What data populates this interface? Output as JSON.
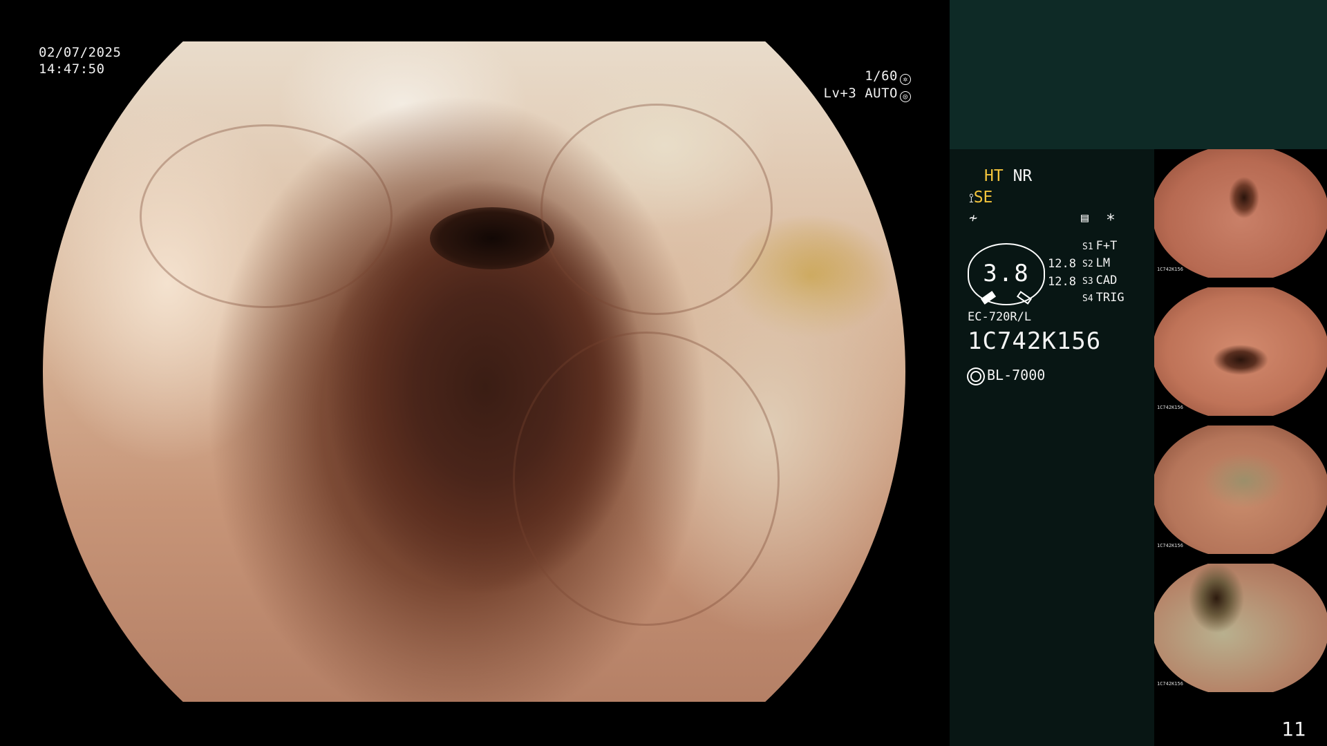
{
  "overlay": {
    "date": "02/07/2025",
    "time": "14:47:50",
    "shutter": "1/60",
    "level": "Lv+3 AUTO"
  },
  "panel": {
    "ht_label": "HT",
    "nr_label": "NR",
    "se_label": "SE",
    "star": "*",
    "dial_value": "3.8",
    "readout_1": "12.8",
    "readout_2": "12.8",
    "modes": [
      {
        "slot": "S1",
        "value": "F+T"
      },
      {
        "slot": "S2",
        "value": "LM"
      },
      {
        "slot": "S3",
        "value": "CAD"
      },
      {
        "slot": "S4",
        "value": "TRIG"
      }
    ],
    "scope_model": "EC-720R/L",
    "serial": "1C742K156",
    "light_source": "BL-7000"
  },
  "thumbnails": [
    {
      "label": "image-1",
      "mini": "1C742K156"
    },
    {
      "label": "image-2",
      "mini": "1C742K156"
    },
    {
      "label": "image-3",
      "mini": "1C742K156"
    },
    {
      "label": "image-4",
      "mini": "1C742K156"
    }
  ],
  "page_number": "11",
  "colors": {
    "panel_top": "#0e2a26",
    "panel_info": "#081614",
    "accent_yellow": "#f4c53c"
  }
}
